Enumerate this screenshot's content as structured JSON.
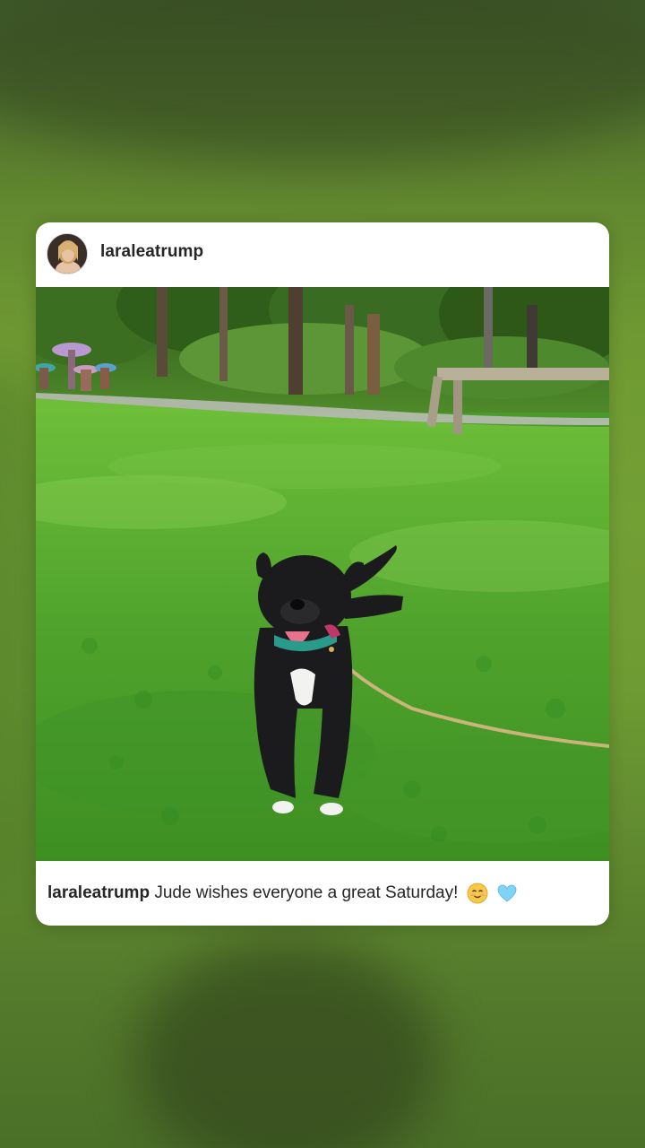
{
  "post": {
    "username": "laraleatrump",
    "caption": {
      "username": "laraleatrump",
      "text": "Jude wishes everyone a great Saturday!",
      "emojis": [
        "smiling-face-emoji",
        "light-blue-heart-emoji"
      ]
    }
  },
  "colors": {
    "background_green": "#6f9a33",
    "card": "#ffffff",
    "text": "#262626",
    "grass": "#4b9a2c"
  }
}
